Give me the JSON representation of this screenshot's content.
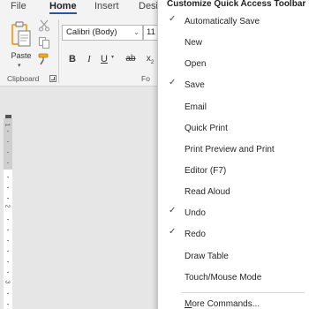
{
  "ribbon": {
    "tabs": [
      {
        "label": "File",
        "active": false
      },
      {
        "label": "Home",
        "active": true
      },
      {
        "label": "Insert",
        "active": false
      },
      {
        "label": "Desi",
        "active": false
      }
    ],
    "clipboard": {
      "paste_label": "Paste",
      "group_label": "Clipboard"
    },
    "font": {
      "font_name": "Calibri (Body)",
      "font_size": "11",
      "group_label_partial": "Fo",
      "bold": "B",
      "italic": "I",
      "underline": "U",
      "strikethrough": "ab",
      "subscript": "x",
      "subscript_suffix": "2"
    }
  },
  "ruler": {
    "numbers": [
      "1",
      "2",
      "3"
    ]
  },
  "menu": {
    "title": "Customize Quick Access Toolbar",
    "items": [
      {
        "label": "Automatically Save",
        "checked": true
      },
      {
        "label": "New",
        "checked": false
      },
      {
        "label": "Open",
        "checked": false
      },
      {
        "label": "Save",
        "checked": true
      },
      {
        "label": "Email",
        "checked": false
      },
      {
        "label": "Quick Print",
        "checked": false
      },
      {
        "label": "Print Preview and Print",
        "checked": false
      },
      {
        "label": "Editor (F7)",
        "checked": false
      },
      {
        "label": "Read Aloud",
        "checked": false
      },
      {
        "label": "Undo",
        "checked": true
      },
      {
        "label": "Redo",
        "checked": true
      },
      {
        "label": "Draw Table",
        "checked": false
      },
      {
        "label": "Touch/Mouse Mode",
        "checked": false
      }
    ],
    "more_commands": {
      "accel": "M",
      "rest": "ore Commands..."
    },
    "check_glyph": "✓"
  },
  "colors": {
    "accent": "#2b579a",
    "paste_icon": "#f0a830"
  }
}
